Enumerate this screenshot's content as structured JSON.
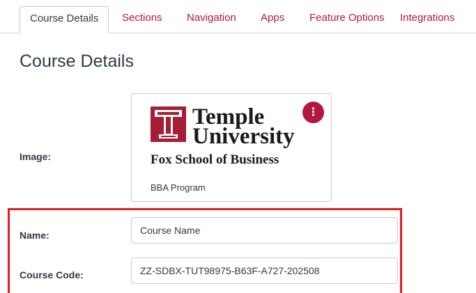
{
  "tabs": [
    {
      "label": "Course Details",
      "active": true
    },
    {
      "label": "Sections"
    },
    {
      "label": "Navigation"
    },
    {
      "label": "Apps"
    },
    {
      "label": "Feature Options"
    },
    {
      "label": "Integrations"
    }
  ],
  "page_title": "Course Details",
  "image": {
    "label": "Image:",
    "logo": {
      "line1": "Temple",
      "line2": "University",
      "line3": "Fox School of Business",
      "mark_icon": "temple-t-icon"
    },
    "caption": "BBA Program",
    "menu_icon": "kebab-menu-icon"
  },
  "form": {
    "name_label": "Name:",
    "name_value": "Course Name",
    "code_label": "Course Code:",
    "code_value": "ZZ-SDBX-TUT98975-B63F-A727-202508"
  },
  "colors": {
    "accent": "#b2173e",
    "text": "#2d3b45",
    "border": "#c7cdd1",
    "highlight": "#e51b24",
    "temple_red": "#a41e35"
  }
}
